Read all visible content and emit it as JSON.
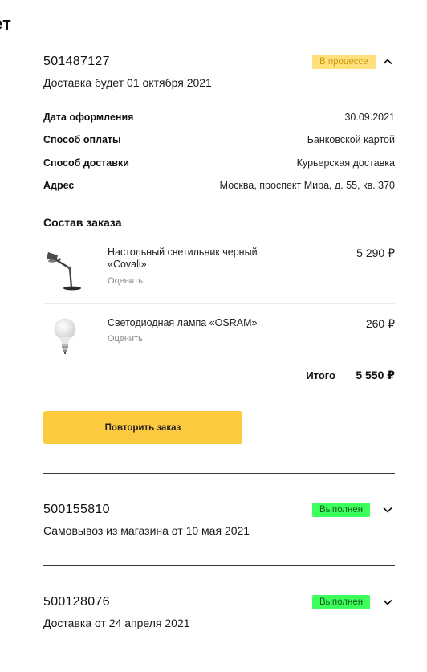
{
  "page": {
    "title": "ет"
  },
  "orders": [
    {
      "number": "501487127",
      "subtitle": "Доставка будет 01 октября 2021",
      "status": "В процессе",
      "details": [
        {
          "label": "Дата оформления",
          "value": "30.09.2021"
        },
        {
          "label": "Способ оплаты",
          "value": "Банковской картой"
        },
        {
          "label": "Способ доставки",
          "value": "Курьерская доставка"
        },
        {
          "label": "Адрес",
          "value": "Москва, проспект Мира, д. 55, кв. 370"
        }
      ],
      "items_title": "Состав заказа",
      "items": [
        {
          "name": "Настольный светильник черный «Covali»",
          "rate": "Оценить",
          "price": "5 290 ₽",
          "image": "desk-lamp"
        },
        {
          "name": "Светодиодная лампа «OSRAM»",
          "rate": "Оценить",
          "price": "260 ₽",
          "image": "light-bulb"
        }
      ],
      "total_label": "Итого",
      "total_value": "5 550 ₽",
      "repeat_label": "Повторить заказ"
    },
    {
      "number": "500155810",
      "subtitle": "Самовывоз из магазина от 10 мая 2021",
      "status": "Выполнен"
    },
    {
      "number": "500128076",
      "subtitle": "Доставка от 24 апреля 2021",
      "status": "Выполнен"
    }
  ],
  "icons": {
    "expanded": "chevron-up-icon",
    "collapsed": "chevron-down-icon"
  },
  "colors": {
    "status_progress_bg": "#ffe07a",
    "status_done_bg": "#3dff5c",
    "button_bg": "#fcca3f"
  }
}
